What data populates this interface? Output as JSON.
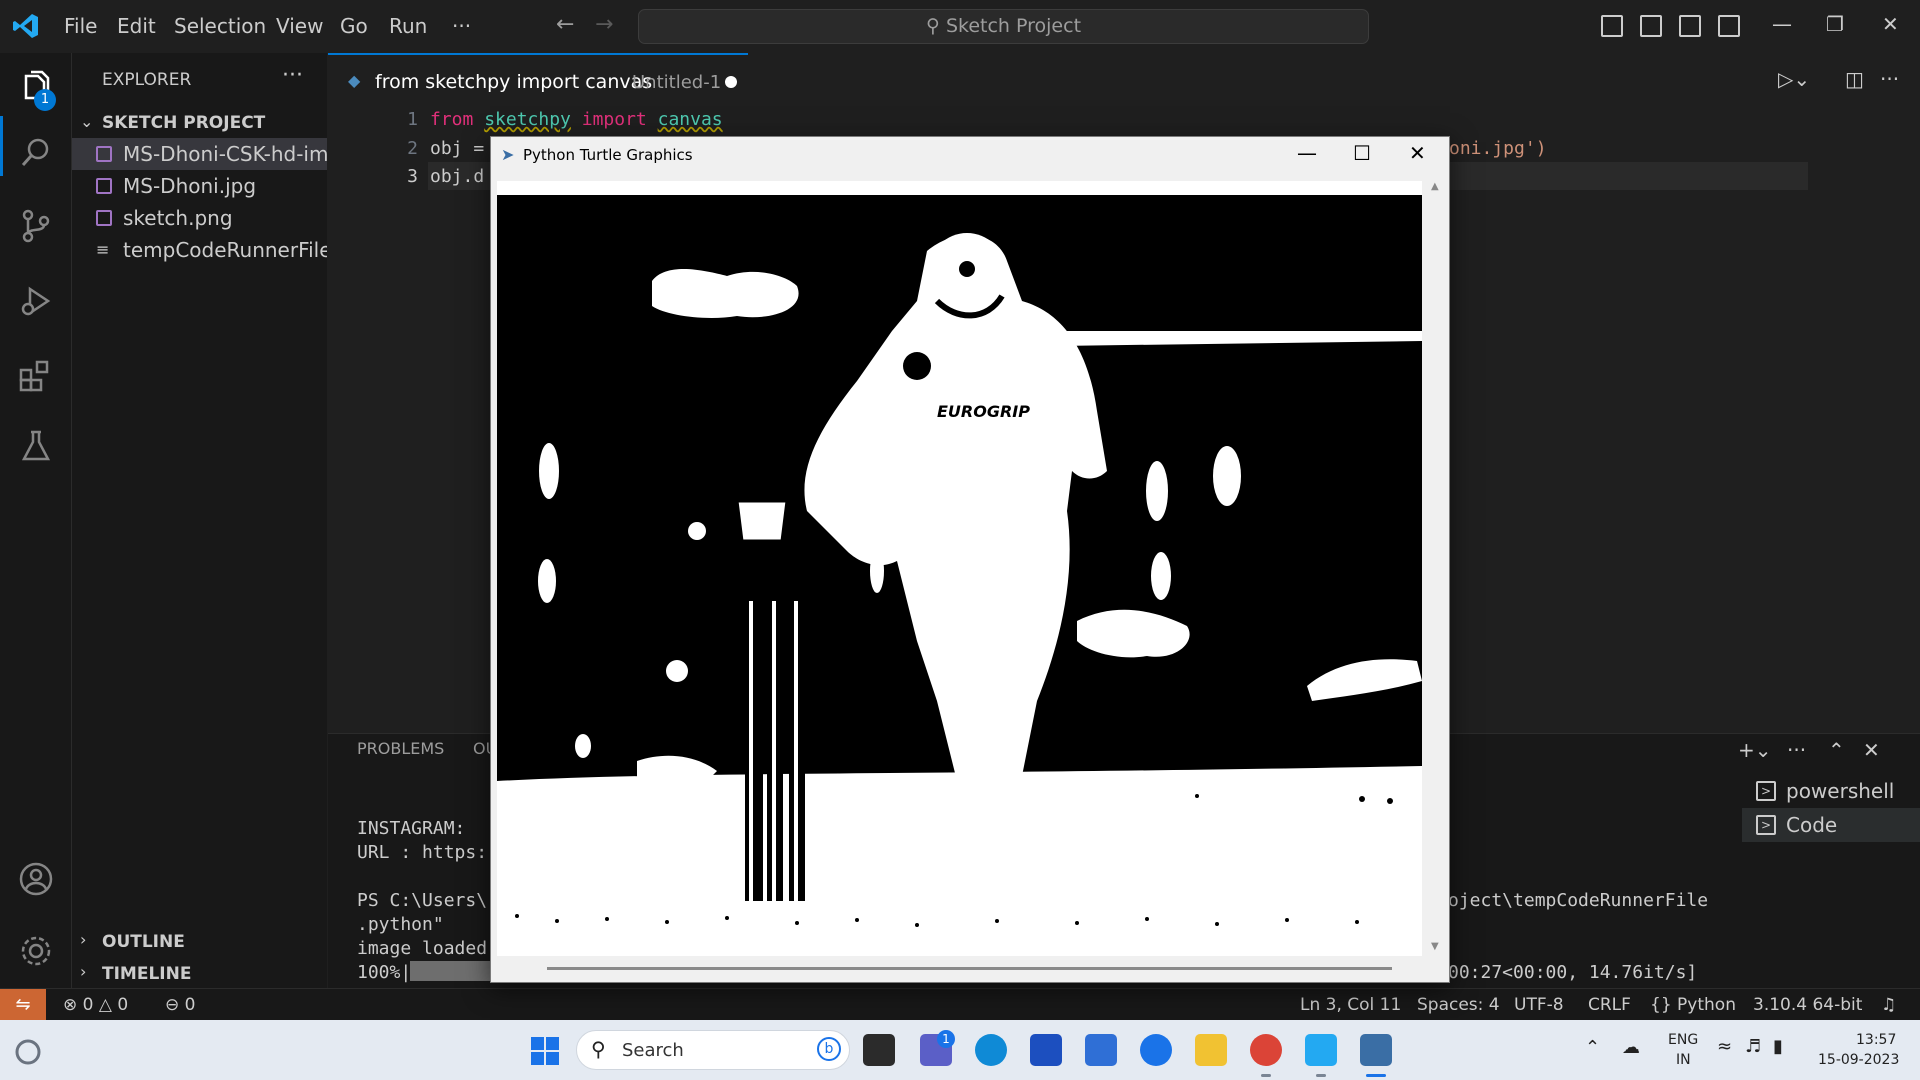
{
  "titlebar": {
    "menu": [
      "File",
      "Edit",
      "Selection",
      "View",
      "Go",
      "Run",
      "···"
    ],
    "command_center": "Sketch Project",
    "back": "←",
    "forward": "→"
  },
  "activitybar": {
    "explorer_badge": "1"
  },
  "sidebar": {
    "title": "EXPLORER",
    "more": "···",
    "project": "SKETCH PROJECT",
    "files": [
      "MS-Dhoni-CSK-hd-im...",
      "MS-Dhoni.jpg",
      "sketch.png",
      "tempCodeRunnerFile...."
    ],
    "outline": "OUTLINE",
    "timeline": "TIMELINE"
  },
  "editor": {
    "tab_title": "from sketchpy import canvas",
    "tab_desc": "Untitled-1",
    "line_numbers": [
      "1",
      "2",
      "3"
    ],
    "line1": {
      "kw_from": "from",
      "module": "sketchpy",
      "kw_import": "import",
      "name": "canvas"
    },
    "line2_start": "obj =",
    "line2_end": "oni.jpg')",
    "line3_start": "obj.d"
  },
  "panel": {
    "tab_problems": "PROBLEMS",
    "tab_output_partial": "OU",
    "terminal_lines": [
      "INSTAGRAM:",
      "URL : https:",
      "",
      "PS C:\\Users\\",
      ".python\"",
      "image loaded",
      "100%|"
    ],
    "terminal_right_1": "oject\\tempCodeRunnerFile",
    "terminal_right_2": "00:27<00:00, 14.76it/s]",
    "terminals": [
      "powershell",
      "Code"
    ]
  },
  "statusbar": {
    "errors": "0",
    "warnings": "0",
    "ports": "0",
    "position": "Ln 3, Col 11",
    "spaces": "Spaces: 4",
    "encoding": "UTF-8",
    "eol": "CRLF",
    "language": "Python",
    "interpreter": "3.10.4 64-bit"
  },
  "turtle_window": {
    "title": "Python Turtle Graphics",
    "minimize": "—",
    "maximize": "☐",
    "close": "✕"
  },
  "taskbar": {
    "search": "Search",
    "teams_badge": "1",
    "lang_top": "ENG",
    "lang_bottom": "IN",
    "time": "13:57",
    "date": "15-09-2023"
  },
  "colors": {
    "accent": "#0078d4",
    "remote": "#cc6633",
    "keyword": "#e0307a",
    "module": "#4ec9b0"
  }
}
